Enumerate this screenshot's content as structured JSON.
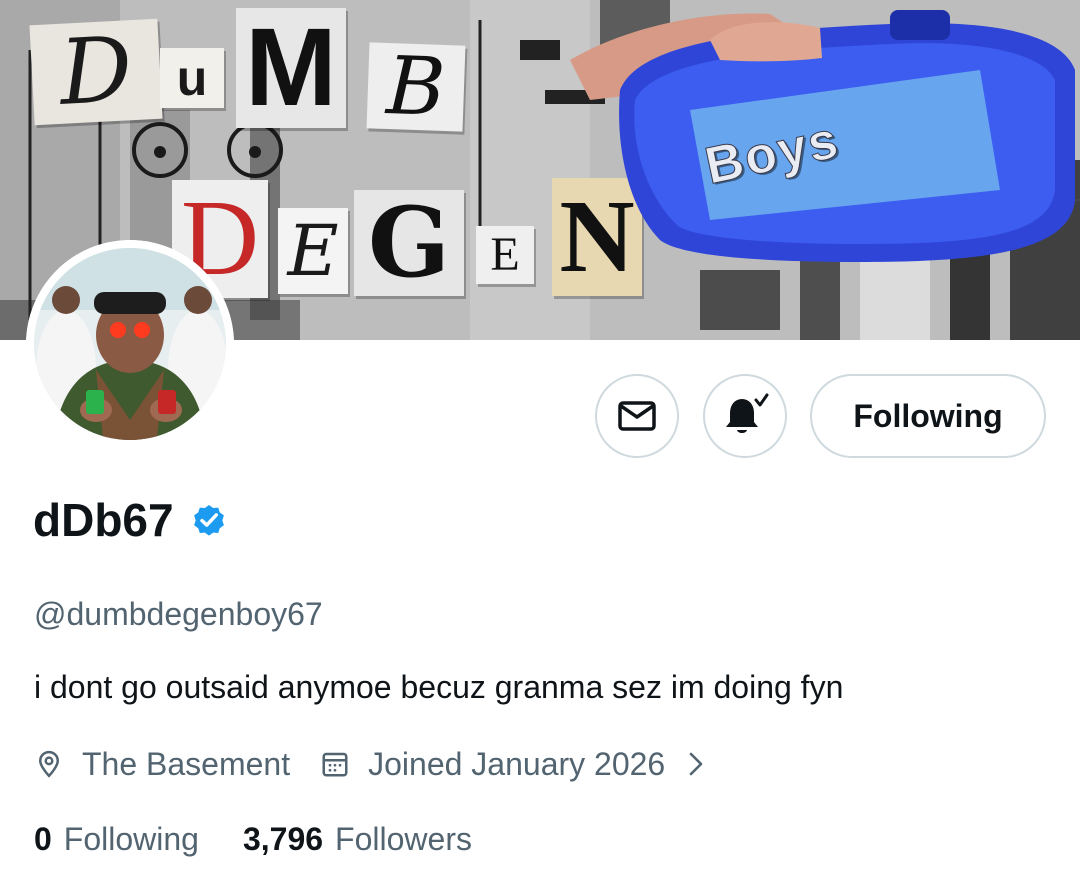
{
  "banner": {
    "title_letters_row1": [
      "D",
      "u",
      "M",
      "B"
    ],
    "title_letters_row2": [
      "D",
      "E",
      "G",
      "E",
      "N"
    ],
    "sticker_text": "Boys"
  },
  "profile": {
    "display_name": "dDb67",
    "verified": true,
    "handle": "@dumbdegenboy67",
    "bio": "i dont go outsaid anymoe becuz granma sez im doing fyn",
    "location": "The Basement",
    "joined": "Joined January 2026",
    "following_count": "0",
    "following_label": "Following",
    "followers_count": "3,796",
    "followers_label": "Followers"
  },
  "actions": {
    "message_icon": "envelope-icon",
    "notify_icon": "bell-check-icon",
    "follow_state_label": "Following"
  },
  "colors": {
    "verified_badge": "#1d9bf0",
    "primary_text": "#0f1419",
    "secondary_text": "#536471",
    "button_border": "#cfd9de"
  }
}
